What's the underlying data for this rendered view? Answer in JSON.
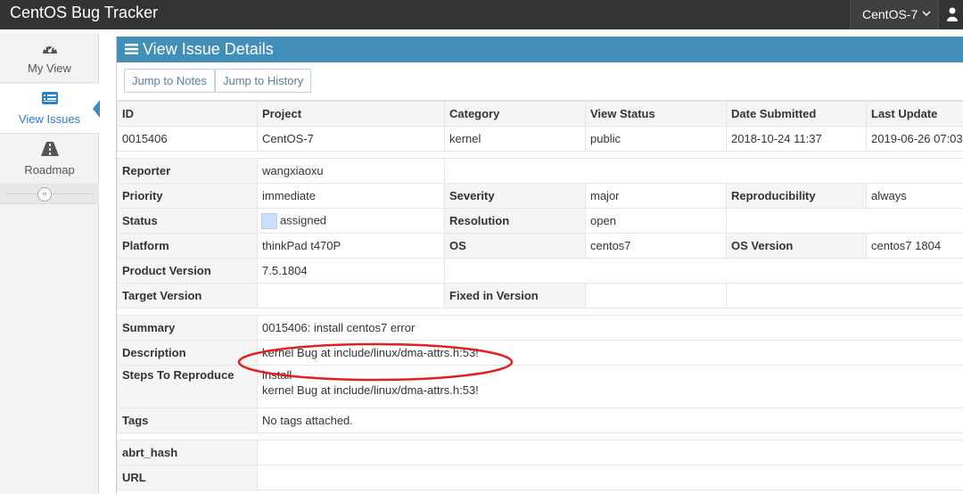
{
  "app": {
    "title": "CentOS Bug Tracker"
  },
  "project_selector": {
    "value": "CentOS-7",
    "icon": "chevron-down-icon"
  },
  "user_menu": {
    "icon": "user-icon"
  },
  "sidebar": {
    "items": [
      {
        "label": "My View",
        "icon": "dashboard-icon",
        "active": false
      },
      {
        "label": "View Issues",
        "icon": "list-icon",
        "active": true
      },
      {
        "label": "Roadmap",
        "icon": "road-icon",
        "active": false
      }
    ],
    "collapse_icon": "double-chevron-left-icon"
  },
  "panel": {
    "title": "View Issue Details",
    "icon": "menu-icon",
    "buttons": {
      "jump_notes": "Jump to Notes",
      "jump_history": "Jump to History"
    }
  },
  "issue": {
    "headers": [
      "ID",
      "Project",
      "Category",
      "View Status",
      "Date Submitted",
      "Last Update"
    ],
    "values": [
      "0015406",
      "CentOS-7",
      "kernel",
      "public",
      "2018-10-24 11:37",
      "2019-06-26 07:03"
    ],
    "labels": {
      "reporter": "Reporter",
      "priority": "Priority",
      "severity": "Severity",
      "reproducibility": "Reproducibility",
      "status": "Status",
      "resolution": "Resolution",
      "platform": "Platform",
      "os": "OS",
      "os_version": "OS Version",
      "product_version": "Product Version",
      "target_version": "Target Version",
      "fixed_in_version": "Fixed in Version",
      "summary": "Summary",
      "description": "Description",
      "steps": "Steps To Reproduce",
      "tags": "Tags",
      "abrt_hash": "abrt_hash",
      "url": "URL"
    },
    "reporter": "wangxiaoxu",
    "priority": "immediate",
    "severity": "major",
    "reproducibility": "always",
    "status": "assigned",
    "status_color": "#c8e0f8",
    "resolution": "open",
    "platform": "thinkPad t470P",
    "os": "centos7",
    "os_version": "centos7 1804",
    "product_version": "7.5.1804",
    "target_version": "",
    "fixed_in_version": "",
    "summary": "0015406: install centos7 error",
    "description": "kernel Bug at include/linux/dma-attrs.h:53!",
    "steps_line1": "install",
    "steps_line2": "kernel Bug at include/linux/dma-attrs.h:53!",
    "tags": "No tags attached.",
    "abrt_hash": "",
    "url": ""
  },
  "colors": {
    "navbar": "#333333",
    "header": "#438eb9",
    "annotation": "#e02020"
  }
}
